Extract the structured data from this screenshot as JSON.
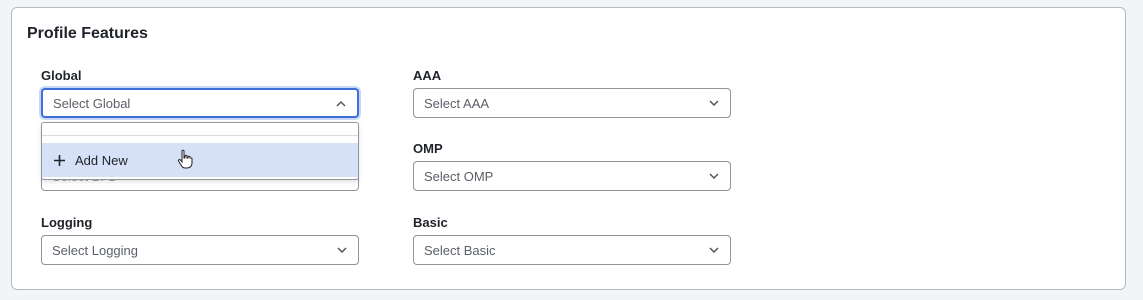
{
  "panel": {
    "title": "Profile Features"
  },
  "fields": {
    "global": {
      "label": "Global",
      "placeholder": "Select Global"
    },
    "aaa": {
      "label": "AAA",
      "placeholder": "Select AAA"
    },
    "bfd": {
      "placeholder": "Select BFD"
    },
    "omp": {
      "label": "OMP",
      "placeholder": "Select OMP"
    },
    "logging": {
      "label": "Logging",
      "placeholder": "Select Logging"
    },
    "basic": {
      "label": "Basic",
      "placeholder": "Select Basic"
    }
  },
  "dropdown": {
    "add_new_label": "Add New"
  },
  "icons": {
    "chevron": "chevron-down-icon",
    "chevron_up": "chevron-up-icon",
    "plus": "plus-icon",
    "cursor": "hand-pointer-icon"
  },
  "colors": {
    "focus": "#3c6fd8",
    "highlight": "#d6e1f7",
    "border": "#8f949d"
  }
}
